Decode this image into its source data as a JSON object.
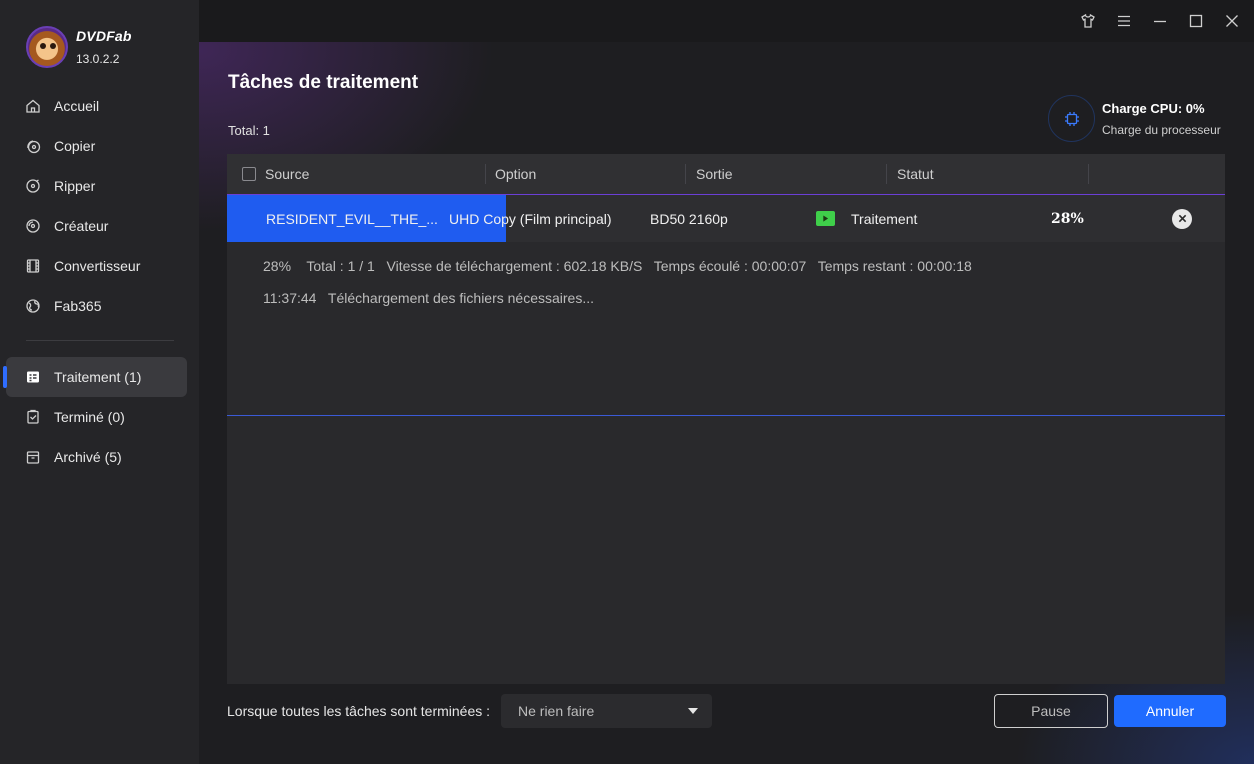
{
  "brand": {
    "name": "DVDFab",
    "version": "13.0.2.2",
    "logo_icon": "monkey-logo-icon"
  },
  "sidebar": {
    "items": [
      {
        "label": "Accueil",
        "icon": "home-icon"
      },
      {
        "label": "Copier",
        "icon": "copy-icon"
      },
      {
        "label": "Ripper",
        "icon": "ripper-icon"
      },
      {
        "label": "Créateur",
        "icon": "creator-icon"
      },
      {
        "label": "Convertisseur",
        "icon": "converter-icon"
      },
      {
        "label": "Fab365",
        "icon": "fab365-icon"
      }
    ],
    "queue": [
      {
        "label": "Traitement (1)",
        "icon": "processing-icon",
        "active": true
      },
      {
        "label": "Terminé (0)",
        "icon": "finished-icon"
      },
      {
        "label": "Archivé (5)",
        "icon": "archive-icon"
      }
    ]
  },
  "window": {
    "controls": [
      "shirt-icon",
      "menu-icon",
      "minimize-icon",
      "maximize-icon",
      "close-icon"
    ]
  },
  "main": {
    "title": "Tâches de traitement",
    "total": "Total: 1",
    "cpu": {
      "load": "Charge CPU: 0%",
      "label": "Charge du processeur"
    },
    "table": {
      "headers": {
        "source": "Source",
        "option": "Option",
        "output": "Sortie",
        "status": "Statut"
      },
      "task": {
        "source": "RESIDENT_EVIL__THE_...",
        "option": "UHD Copy (Film principal)",
        "output": "BD50 2160p",
        "status": "Traitement",
        "percent": "28%",
        "progress": 0.28,
        "details": {
          "percent": "28%",
          "total": "Total : 1 / 1",
          "speed": "Vitesse de téléchargement : 602.18 KB/S",
          "elapsed": "Temps écoulé : 00:00:07",
          "remaining": "Temps restant : 00:00:18"
        },
        "log": {
          "time": "11:37:44",
          "message": "Téléchargement des fichiers nécessaires..."
        }
      }
    },
    "footer": {
      "when_done_label": "Lorsque toutes les tâches sont terminées :",
      "when_done_value": "Ne rien faire",
      "pause": "Pause",
      "cancel": "Annuler"
    }
  },
  "colors": {
    "accent": "#1f6bff",
    "progress": "#1f5cf0",
    "status_play": "#3fcf4a"
  }
}
